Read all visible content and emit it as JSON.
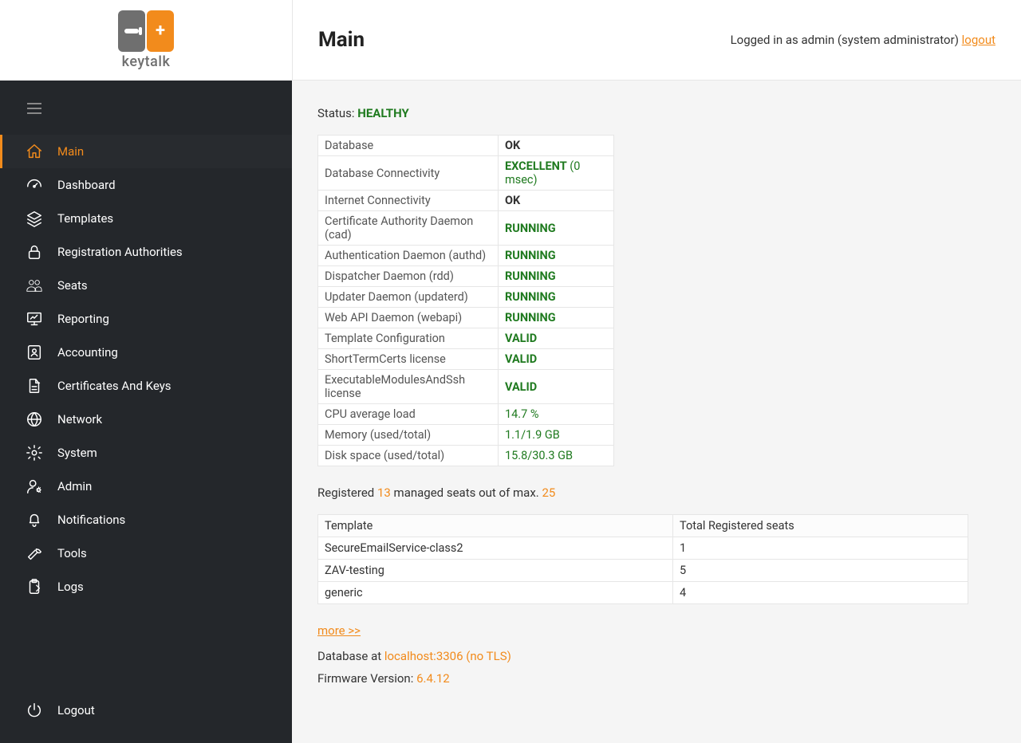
{
  "brand": {
    "name": "keytalk"
  },
  "header": {
    "title": "Main",
    "login_prefix": "Logged in as admin (system administrator) ",
    "logout_label": "logout"
  },
  "sidebar": {
    "items": [
      {
        "label": "Main",
        "icon": "home",
        "active": true
      },
      {
        "label": "Dashboard",
        "icon": "gauge"
      },
      {
        "label": "Templates",
        "icon": "layers"
      },
      {
        "label": "Registration Authorities",
        "icon": "lock"
      },
      {
        "label": "Seats",
        "icon": "people"
      },
      {
        "label": "Reporting",
        "icon": "presentation"
      },
      {
        "label": "Accounting",
        "icon": "id-card"
      },
      {
        "label": "Certificates And Keys",
        "icon": "file"
      },
      {
        "label": "Network",
        "icon": "globe"
      },
      {
        "label": "System",
        "icon": "gear"
      },
      {
        "label": "Admin",
        "icon": "admin-user"
      },
      {
        "label": "Notifications",
        "icon": "bell"
      },
      {
        "label": "Tools",
        "icon": "wrench"
      },
      {
        "label": "Logs",
        "icon": "clipboard"
      }
    ],
    "logout": {
      "label": "Logout",
      "icon": "power"
    }
  },
  "status": {
    "label": "Status: ",
    "value": "HEALTHY",
    "rows": [
      {
        "name": "Database",
        "value": "OK",
        "style": "bold"
      },
      {
        "name": "Database Connectivity",
        "value_html": "<span class='val-green-bold'>EXCELLENT</span> <span class='val-green'>(0 msec)</span>",
        "style": "custom"
      },
      {
        "name": "Internet Connectivity",
        "value": "OK",
        "style": "bold"
      },
      {
        "name": "Certificate Authority Daemon (cad)",
        "value": "RUNNING",
        "style": "greenbold"
      },
      {
        "name": "Authentication Daemon (authd)",
        "value": "RUNNING",
        "style": "greenbold"
      },
      {
        "name": "Dispatcher Daemon (rdd)",
        "value": "RUNNING",
        "style": "greenbold"
      },
      {
        "name": "Updater Daemon (updaterd)",
        "value": "RUNNING",
        "style": "greenbold"
      },
      {
        "name": "Web API Daemon (webapi)",
        "value": "RUNNING",
        "style": "greenbold"
      },
      {
        "name": "Template Configuration",
        "value": "VALID",
        "style": "greenbold"
      },
      {
        "name": "ShortTermCerts license",
        "value": "VALID",
        "style": "greenbold"
      },
      {
        "name": "ExecutableModulesAndSsh license",
        "value": "VALID",
        "style": "greenbold"
      },
      {
        "name": "CPU average load",
        "value": "14.7 %",
        "style": "green"
      },
      {
        "name": "Memory (used/total)",
        "value": "1.1/1.9 GB",
        "style": "green"
      },
      {
        "name": "Disk space (used/total)",
        "value": "15.8/30.3 GB",
        "style": "green"
      }
    ]
  },
  "seats": {
    "text_pre": "Registered ",
    "count": "13",
    "text_mid": " managed seats out of max. ",
    "max": "25",
    "headers": {
      "template": "Template",
      "total": "Total Registered seats"
    },
    "rows": [
      {
        "template": "SecureEmailService-class2",
        "total": "1"
      },
      {
        "template": "ZAV-testing",
        "total": "5"
      },
      {
        "template": "generic",
        "total": "4"
      }
    ]
  },
  "footer": {
    "more": "more >>",
    "db_prefix": "Database at ",
    "db_link": "localhost:3306 (no TLS)",
    "fw_prefix": "Firmware Version: ",
    "fw_version": "6.4.12"
  }
}
